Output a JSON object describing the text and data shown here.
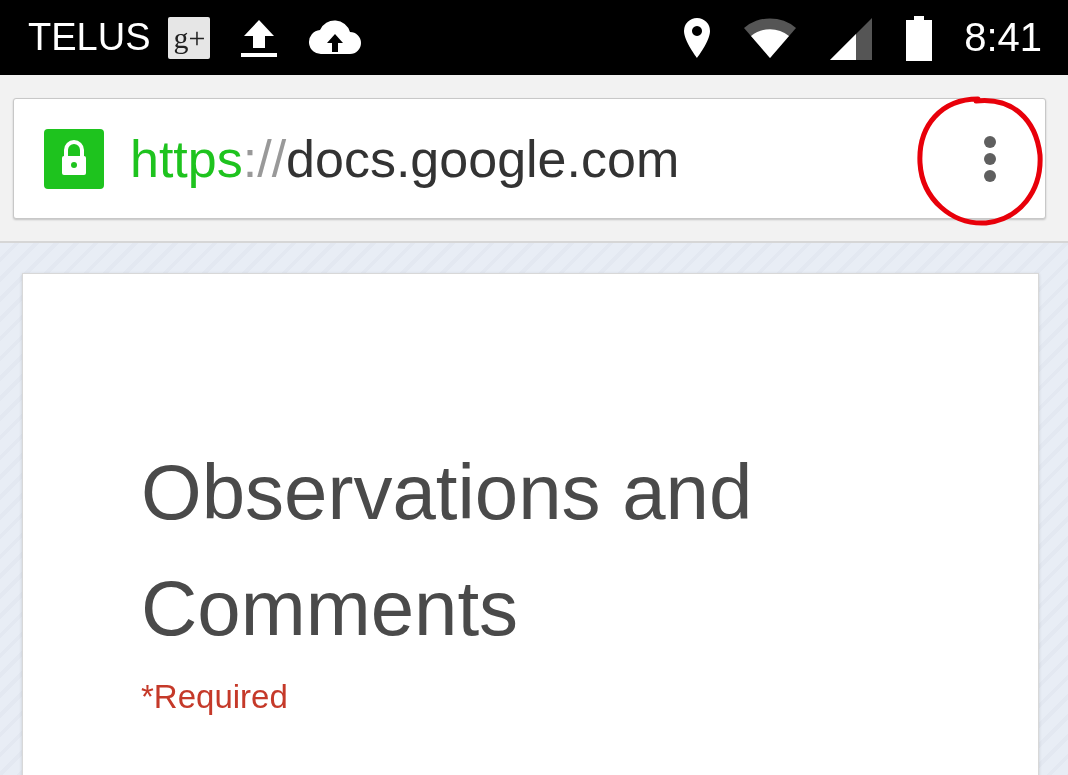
{
  "status_bar": {
    "carrier": "TELUS",
    "badge": "g+",
    "time": "8:41"
  },
  "address_bar": {
    "secure": true,
    "scheme": "https",
    "separator": "://",
    "host": "docs.google.com"
  },
  "form": {
    "title": "Observations and Comments",
    "required_note": "*Required"
  }
}
